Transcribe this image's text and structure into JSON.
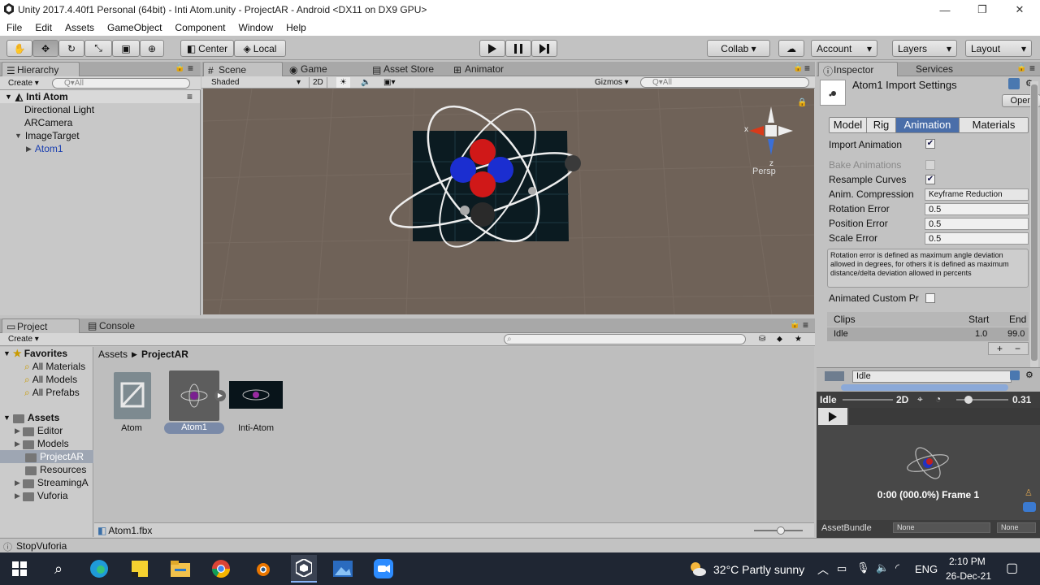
{
  "window": {
    "title": "Unity 2017.4.40f1 Personal (64bit) - Inti Atom.unity - ProjectAR - Android <DX11 on DX9 GPU>"
  },
  "menu": [
    "File",
    "Edit",
    "Assets",
    "GameObject",
    "Component",
    "Window",
    "Help"
  ],
  "toolbar": {
    "center": "Center",
    "local": "Local",
    "collab": "Collab ▾",
    "account": "Account",
    "layers": "Layers",
    "layout": "Layout"
  },
  "hierarchy": {
    "tab": "Hierarchy",
    "create": "Create ▾",
    "search": "Q▾All",
    "scene": "Inti Atom",
    "items": [
      "Directional Light",
      "ARCamera",
      "ImageTarget",
      "Atom1"
    ]
  },
  "scene_view": {
    "tabs": [
      "Scene",
      "Game",
      "Asset Store",
      "Animator"
    ],
    "shading": "Shaded",
    "mode_2d": "2D",
    "gizmos": "Gizmos ▾",
    "search": "Q▾All",
    "persp": "Persp",
    "axis_x": "x",
    "axis_z": "z"
  },
  "inspector": {
    "tabs": [
      "Inspector",
      "Services"
    ],
    "title": "Atom1 Import Settings",
    "open": "Open",
    "subtabs": [
      "Model",
      "Rig",
      "Animation",
      "Materials"
    ],
    "import_animation": "Import Animation",
    "bake_animations": "Bake Animations",
    "resample_curves": "Resample Curves",
    "anim_compression": "Anim. Compression",
    "anim_compression_value": "Keyframe Reduction",
    "rotation_error": "Rotation Error",
    "rotation_error_value": "0.5",
    "position_error": "Position Error",
    "position_error_value": "0.5",
    "scale_error": "Scale Error",
    "scale_error_value": "0.5",
    "help": "Rotation error is defined as maximum angle deviation allowed in degrees, for others it is defined as maximum distance/delta deviation allowed in percents",
    "animated_custom": "Animated Custom Pr",
    "clips_header": "Clips",
    "start_header": "Start",
    "end_header": "End",
    "clip_name": "Idle",
    "clip_start": "1.0",
    "clip_end": "99.0",
    "plus": "+",
    "minus": "−",
    "clip_field": "Idle"
  },
  "preview": {
    "clip": "Idle",
    "mode": "2D",
    "speed": "0.31",
    "time": "0:00 (000.0%) Frame 1",
    "assetbundle": "AssetBundle",
    "none1": "None",
    "none2": "None"
  },
  "project": {
    "tabs": [
      "Project",
      "Console"
    ],
    "create": "Create ▾",
    "favorites": "Favorites",
    "fav_items": [
      "All Materials",
      "All Models",
      "All Prefabs"
    ],
    "assets": "Assets",
    "asset_folders": [
      "Editor",
      "Models",
      "ProjectAR",
      "Resources",
      "StreamingA",
      "Vuforia"
    ],
    "breadcrumb": [
      "Assets",
      "ProjectAR"
    ],
    "files": [
      "Atom",
      "Atom1",
      "Inti-Atom"
    ],
    "selected_file": "Atom1.fbx"
  },
  "status": "StopVuforia",
  "taskbar": {
    "weather": "32°C  Partly sunny",
    "lang": "ENG",
    "time": "2:10 PM",
    "date": "26-Dec-21"
  }
}
